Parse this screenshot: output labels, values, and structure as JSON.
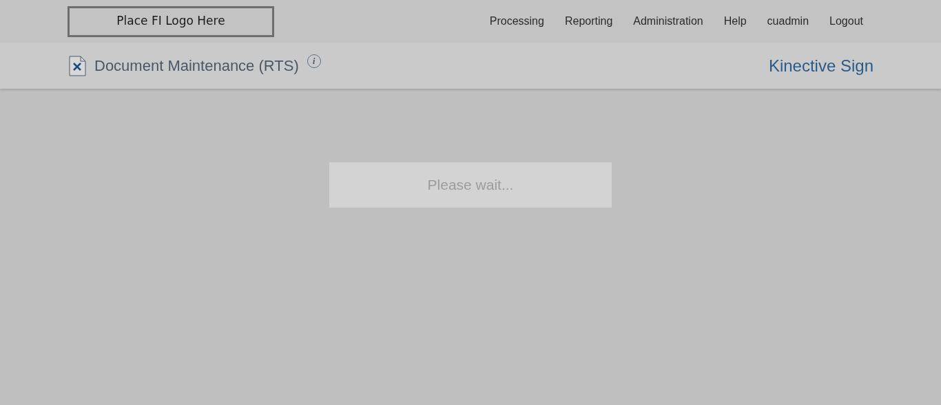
{
  "logo": {
    "text": "Place FI Logo Here"
  },
  "nav": [
    "Processing",
    "Reporting",
    "Administration",
    "Help",
    "cuadmin",
    "Logout"
  ],
  "page_header": {
    "title": "Document Maintenance (RTS)",
    "info": "i",
    "product": "Kinective Sign"
  },
  "loading": {
    "message": "Please wait..."
  }
}
